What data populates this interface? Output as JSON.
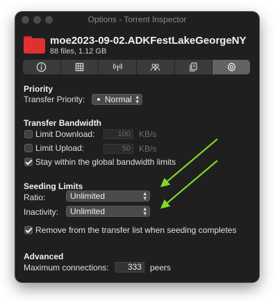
{
  "window": {
    "title": "Options - Torrent Inspector"
  },
  "torrent": {
    "name": "moe2023-09-02.ADKFestLakeGeorgeNY",
    "summary": "88 files, 1.12 GB"
  },
  "tabs": [
    {
      "icon": "info-icon"
    },
    {
      "icon": "grid-icon"
    },
    {
      "icon": "antenna-icon"
    },
    {
      "icon": "peers-icon"
    },
    {
      "icon": "files-icon"
    },
    {
      "icon": "gear-icon",
      "selected": true
    }
  ],
  "priority": {
    "heading": "Priority",
    "label": "Transfer Priority:",
    "value": "Normal"
  },
  "bandwidth": {
    "heading": "Transfer Bandwidth",
    "limit_download": {
      "label": "Limit Download:",
      "value": "100",
      "unit": "KB/s",
      "checked": false
    },
    "limit_upload": {
      "label": "Limit Upload:",
      "value": "50",
      "unit": "KB/s",
      "checked": false
    },
    "global_limits": {
      "label": "Stay within the global bandwidth limits",
      "checked": true
    }
  },
  "seeding": {
    "heading": "Seeding Limits",
    "ratio_label": "Ratio:",
    "ratio_value": "Unlimited",
    "inactivity_label": "Inactivity:",
    "inactivity_value": "Unlimited",
    "remove_label": "Remove from the transfer list when seeding completes",
    "remove_checked": true
  },
  "advanced": {
    "heading": "Advanced",
    "max_conn_label": "Maximum connections:",
    "max_conn_value": "333",
    "max_conn_unit": "peers"
  },
  "colors": {
    "folder": "#e03131",
    "annotation_arrow": "#7fd82a",
    "window_bg": "#1f1f1f"
  }
}
